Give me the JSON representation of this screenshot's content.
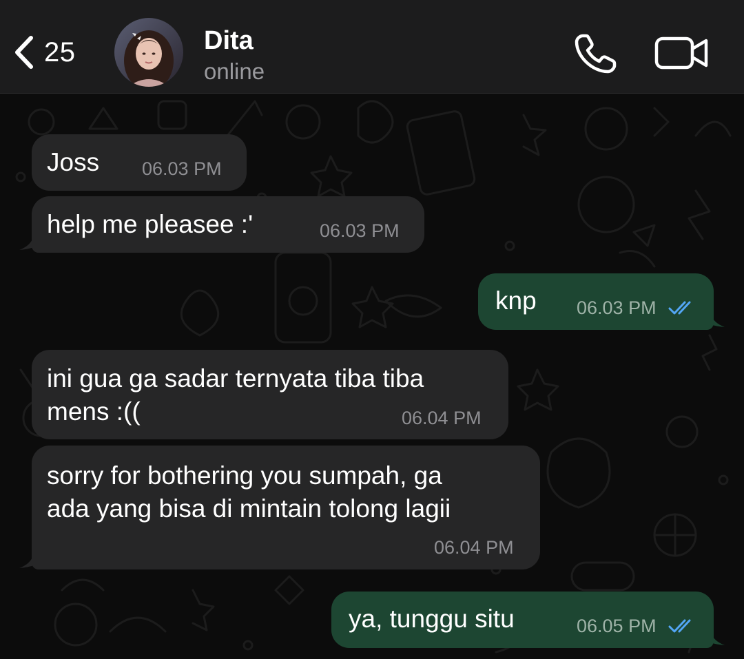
{
  "header": {
    "back_icon": "chevron-left-icon",
    "unread_count": "25",
    "contact_name": "Dita",
    "contact_status": "online",
    "call_icon": "phone-icon",
    "video_icon": "video-camera-icon"
  },
  "colors": {
    "header_bg": "#1c1c1d",
    "chat_bg": "#0c0c0c",
    "incoming_bubble": "#262627",
    "outgoing_bubble": "#1d4632",
    "read_tick": "#53a6f5"
  },
  "messages": [
    {
      "direction": "incoming",
      "text": "Joss",
      "time": "06.03 PM"
    },
    {
      "direction": "incoming",
      "text": "help me pleasee :'",
      "time": "06.03 PM"
    },
    {
      "direction": "outgoing",
      "text": "knp",
      "time": "06.03 PM",
      "status": "read"
    },
    {
      "direction": "incoming",
      "text": "ini gua ga sadar ternyata tiba tiba\nmens :((",
      "time": "06.04 PM"
    },
    {
      "direction": "incoming",
      "text": "sorry for bothering you sumpah, ga\nada yang bisa di mintain tolong lagii",
      "time": "06.04 PM"
    },
    {
      "direction": "outgoing",
      "text": "ya, tunggu situ",
      "time": "06.05 PM",
      "status": "read"
    }
  ]
}
